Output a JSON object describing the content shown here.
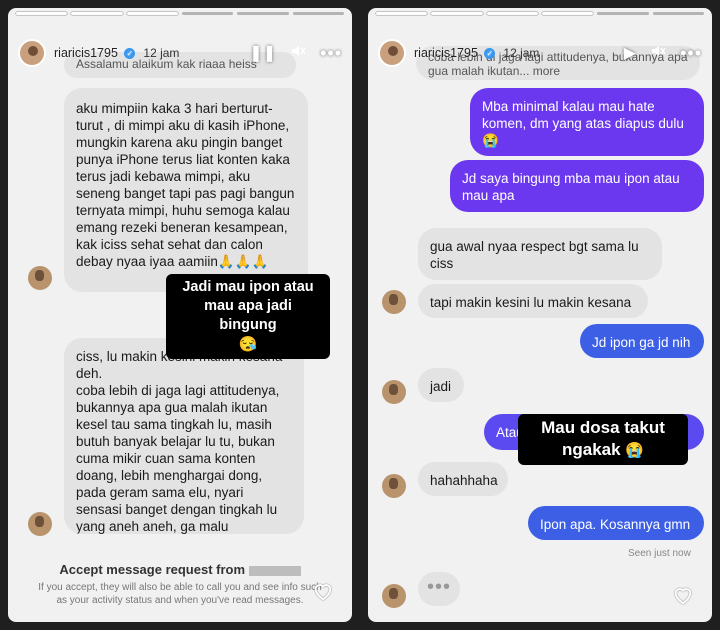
{
  "left_story": {
    "username": "riaricis1795",
    "time": "12 jam",
    "top_partial_message": "Assalamu alaikum kak riaaa heiss",
    "message_1": "aku mimpiin kaka 3 hari berturut-turut , di mimpi aku di kasih iPhone, mungkin karena aku pingin banget punya iPhone terus liat konten kaka terus jadi kebawa mimpi, aku seneng banget tapi pas pagi bangun ternyata mimpi, huhu semoga kalau emang rezeki beneran kesampean, kak iciss sehat sehat dan calon debay nyaa iyaa aamiin🙏🙏🙏",
    "caption": "Jadi mau ipon atau mau apa jadi bingung",
    "caption_emoji": "😪",
    "message_2": "ciss, lu makin kesini makin kesana deh.\ncoba lebih di jaga lagi attitudenya, bukannya apa gua malah ikutan kesel tau sama tingkah lu, masih butuh banyak belajar lu tu, bukan cuma mikir cuan sama konten doang, lebih menghargai dong, pada geram sama elu, nyari sensasi banget dengan tingkah lu yang aneh aneh, ga malu",
    "accept_title": "Accept message request from",
    "accept_text": "If you accept, they will also be able to call you and see info such as your activity status and when you've read messages."
  },
  "right_story": {
    "username": "riaricis1795",
    "time": "12 jam",
    "top_partial_message": "coba lebih di jaga lagi attitudenya, bukannya apa gua malah ikutan... more",
    "messages": [
      {
        "from": "me",
        "text": "Mba minimal kalau mau hate komen, dm yang atas diapus dulu 😭"
      },
      {
        "from": "me",
        "text": "Jd saya bingung mba mau ipon atau mau apa"
      },
      {
        "from": "them",
        "text": "gua awal nyaa respect bgt sama lu ciss"
      },
      {
        "from": "them",
        "text": "tapi makin kesini lu makin kesana"
      },
      {
        "from": "me",
        "text": "Jd ipon ga jd nih"
      },
      {
        "from": "them",
        "text": "jadi"
      },
      {
        "from": "me",
        "text": "Atau"
      },
      {
        "from": "them",
        "text": "hahahhaha"
      },
      {
        "from": "me",
        "text": "Ipon apa. Kosannya gmn"
      }
    ],
    "caption": "Mau dosa takut ngakak",
    "caption_emoji": "😭",
    "seen": "Seen just now",
    "typing": "•••"
  },
  "icons": {
    "pause": "pause-icon",
    "mute": "mute-icon",
    "more": "more-icon",
    "play": "play-icon",
    "heart": "heart-icon"
  }
}
